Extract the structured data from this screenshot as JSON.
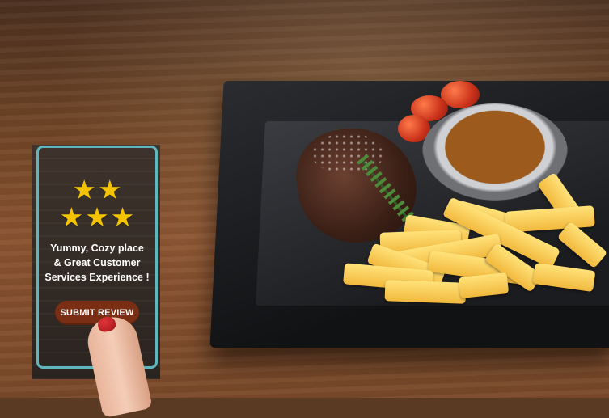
{
  "review": {
    "rating": 5,
    "rating_max": 5,
    "star_color": "#f5c400",
    "frame_color": "#5fb7bd",
    "text": "Yummy, Cozy place\n& Great Customer\nServices Experience !",
    "submit_label": "SUBMIT REVIEW",
    "submit_color": "#7a2f14"
  },
  "icons": {
    "star": "star-icon"
  }
}
